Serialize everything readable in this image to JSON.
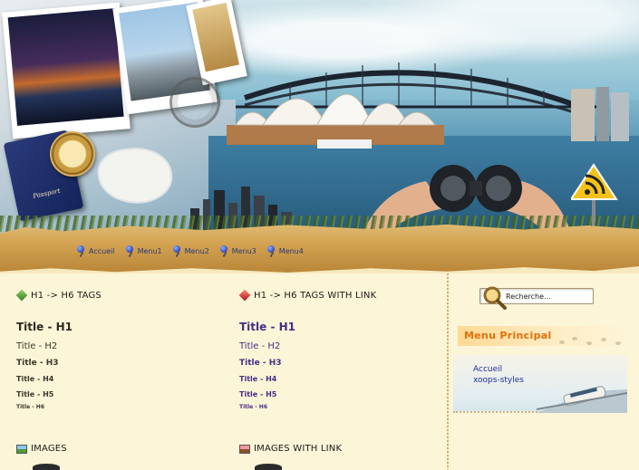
{
  "nav": {
    "items": [
      {
        "label": "Accueil"
      },
      {
        "label": "Menu1"
      },
      {
        "label": "Menu2"
      },
      {
        "label": "Menu3"
      },
      {
        "label": "Menu4"
      }
    ]
  },
  "header": {
    "passport_text": "Passport"
  },
  "col1": {
    "section_title": "H1 -> H6 TAGS",
    "h1": "Title - H1",
    "h2": "Title - H2",
    "h3": "Title - H3",
    "h4": "Title - H4",
    "h5": "Title - H5",
    "h6": "Title - H6",
    "images_title": "IMAGES"
  },
  "col2": {
    "section_title": "H1 -> H6 TAGS WITH LINK",
    "h1": "Title - H1",
    "h2": "Title - H2",
    "h3": "Title - H3",
    "h4": "Title - H4",
    "h5": "Title - H5",
    "h6": "Title - H6",
    "images_title": "IMAGES WITH LINK"
  },
  "sidebar": {
    "search": {
      "value": "Recherche..."
    },
    "menu_title": "Menu Principal",
    "links": [
      {
        "label": "Accueil"
      },
      {
        "label": "xoops-styles"
      }
    ]
  },
  "colors": {
    "nav_link": "#233a7a",
    "heading_link": "#4b2b86",
    "menu_title": "#e0700a",
    "menu_link": "#1f2e9a"
  }
}
